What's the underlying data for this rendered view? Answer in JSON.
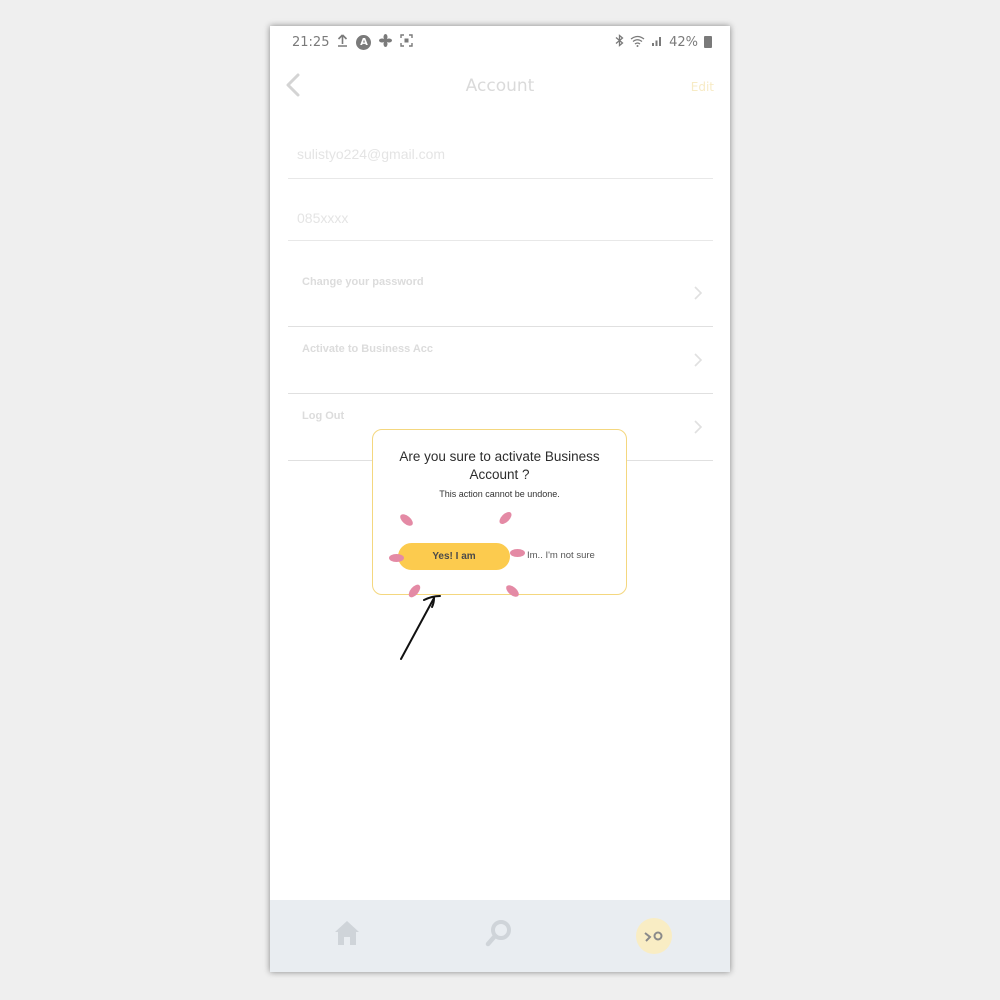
{
  "status_bar": {
    "time": "21:25",
    "battery": "42%"
  },
  "header": {
    "title": "Account",
    "edit_label": "Edit"
  },
  "fields": {
    "email": "sulistyo224@gmail.com",
    "phone": "085xxxx"
  },
  "menu": {
    "items": [
      {
        "label": "Change your password"
      },
      {
        "label": "Activate to Business Acc"
      },
      {
        "label": "Log Out"
      }
    ]
  },
  "dialog": {
    "title": "Are you sure to activate Business Account ?",
    "subtitle": "This action cannot be undone.",
    "confirm_label": "Yes! I am",
    "cancel_label": "Im.. I'm not sure"
  },
  "colors": {
    "accent_yellow": "#fccb4e",
    "dialog_border": "#f4d77f",
    "sparkle_pink": "#e48aa5",
    "nav_background": "#e9edf1"
  },
  "icons": {
    "back": "chevron-left-icon",
    "row": "chevron-right-icon",
    "home": "home-icon",
    "search": "search-icon",
    "profile": "profile-avatar-icon"
  }
}
